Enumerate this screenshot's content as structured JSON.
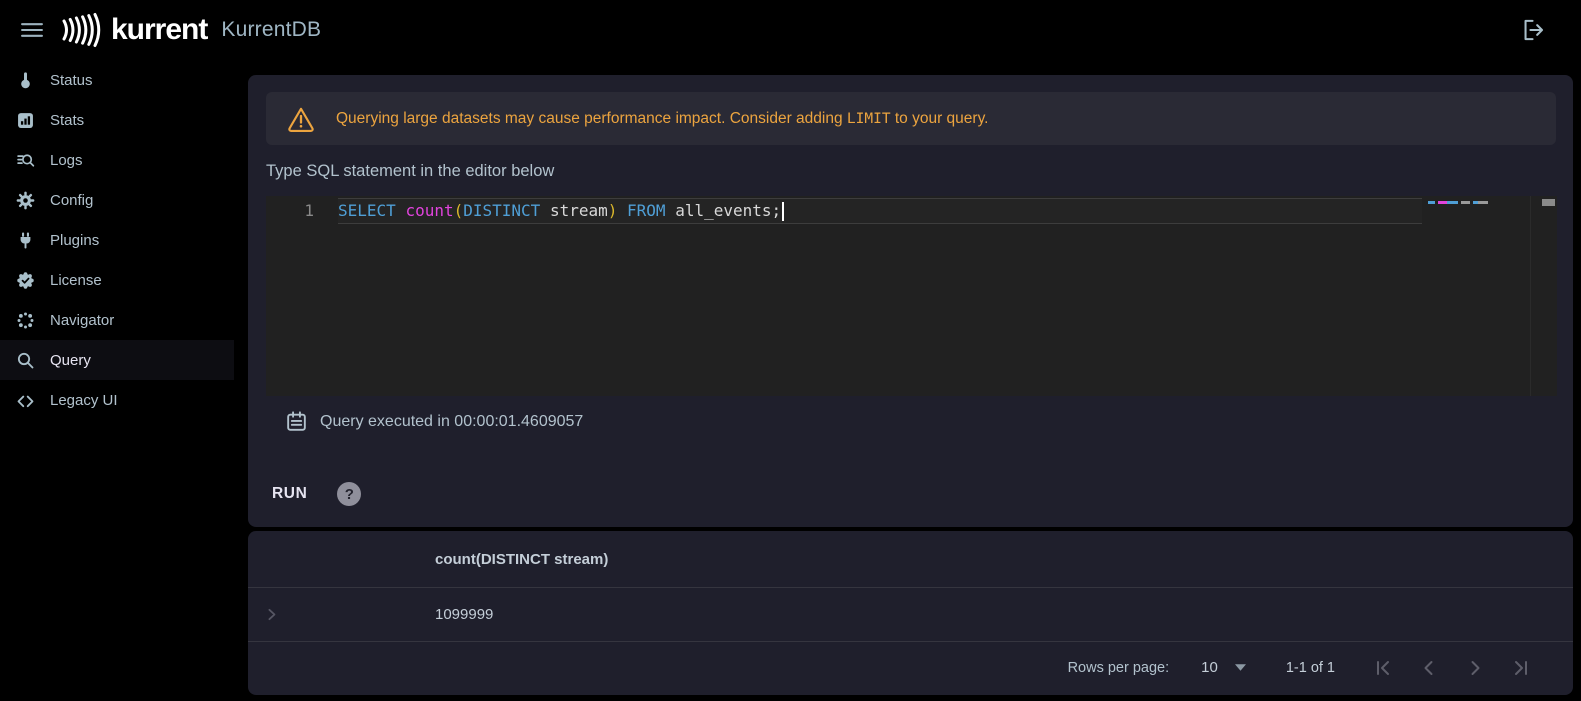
{
  "colors": {
    "bg": "#000000",
    "card": "#1f1f2c",
    "banner": "#2a2a35",
    "editor-bg": "#212121",
    "editor-line": "#8a8a8a",
    "accent-orange": "#eca43f",
    "sql-keyword": "#4f9fd6",
    "sql-function": "#e143dc",
    "sql-paren": "#d9b62b",
    "sql-text": "#d8d8d8",
    "text-primary": "#b2c2cd",
    "text-bright": "#e6e4f1",
    "icon": "#a9bfca",
    "divider": "#35353f",
    "pager-disabled": "#5e5e6a",
    "help-bg": "#8f8f9b",
    "table-text": "#c4ced8",
    "cursor": "#ffffff",
    "active-bg": "#0d0d12"
  },
  "topbar": {
    "brand": "kurrent",
    "app_title": "KurrentDB"
  },
  "sidebar": {
    "items": [
      {
        "label": "Status",
        "icon": "thermometer-icon",
        "active": false
      },
      {
        "label": "Stats",
        "icon": "bar-chart-icon",
        "active": false
      },
      {
        "label": "Logs",
        "icon": "log-search-icon",
        "active": false
      },
      {
        "label": "Config",
        "icon": "gear-icon",
        "active": false
      },
      {
        "label": "Plugins",
        "icon": "plug-icon",
        "active": false
      },
      {
        "label": "License",
        "icon": "license-badge-icon",
        "active": false
      },
      {
        "label": "Navigator",
        "icon": "navigator-dots-icon",
        "active": false
      },
      {
        "label": "Query",
        "icon": "search-icon",
        "active": true
      },
      {
        "label": "Legacy UI",
        "icon": "code-brackets-icon",
        "active": false
      }
    ]
  },
  "query_page": {
    "warning": {
      "text_before": "Querying large datasets may cause performance impact. Consider adding ",
      "code": "LIMIT",
      "text_after": " to your query."
    },
    "editor_label": "Type SQL statement in the editor below",
    "editor": {
      "line_number": "1",
      "sql": "SELECT count(DISTINCT stream) FROM all_events;",
      "tokens": [
        {
          "text": "SELECT",
          "type": "keyword"
        },
        {
          "text": " ",
          "type": "plain"
        },
        {
          "text": "count",
          "type": "function"
        },
        {
          "text": "(",
          "type": "paren"
        },
        {
          "text": "DISTINCT",
          "type": "keyword"
        },
        {
          "text": " stream",
          "type": "plain"
        },
        {
          "text": ")",
          "type": "paren"
        },
        {
          "text": " ",
          "type": "plain"
        },
        {
          "text": "FROM",
          "type": "keyword"
        },
        {
          "text": " all_events;",
          "type": "plain"
        }
      ]
    },
    "status_text": "Query executed in 00:00:01.4609057",
    "run_label": "RUN",
    "help_label": "?"
  },
  "results": {
    "columns": [
      "count(DISTINCT stream)"
    ],
    "rows": [
      [
        "1099999"
      ]
    ],
    "pagination": {
      "rows_per_page_label": "Rows per page:",
      "rows_per_page_value": "10",
      "range_label": "1-1 of 1"
    }
  }
}
